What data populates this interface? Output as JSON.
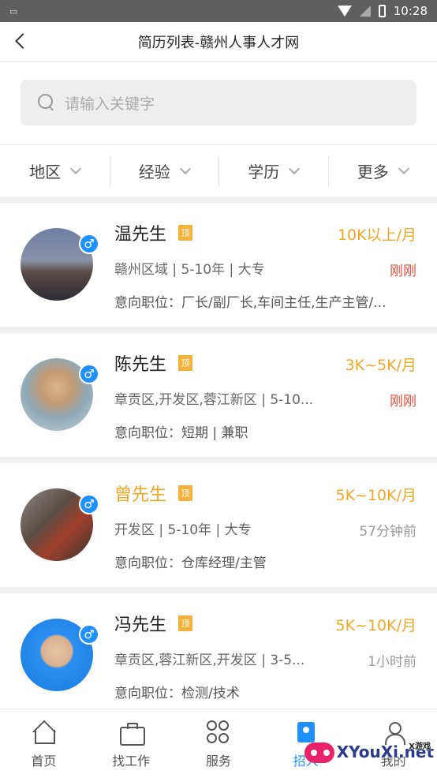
{
  "status_bar": {
    "left_icon": "notification-icon",
    "time": "10:28"
  },
  "header": {
    "title": "简历列表-赣州人事人才网"
  },
  "search": {
    "placeholder": "请输入关键字"
  },
  "filters": [
    {
      "label": "地区"
    },
    {
      "label": "经验"
    },
    {
      "label": "学历"
    },
    {
      "label": "更多"
    }
  ],
  "top_badge": "顶",
  "gender_symbol": "♂",
  "accent_color": "#f5a623",
  "link_blue": "#1e90ff",
  "resumes": [
    {
      "name": "温先生",
      "highlighted": false,
      "salary": "10K以上/月",
      "info": "赣州区域 | 5-10年 | 大专",
      "time": "刚刚",
      "time_new": true,
      "intent": "意向职位：厂长/副厂长,车间主任,生产主管/..."
    },
    {
      "name": "陈先生",
      "highlighted": false,
      "salary": "3K~5K/月",
      "info": "章贡区,开发区,蓉江新区 | 5-10...",
      "time": "刚刚",
      "time_new": true,
      "intent": "意向职位：短期 | 兼职"
    },
    {
      "name": "曾先生",
      "highlighted": true,
      "salary": "5K~10K/月",
      "info": "开发区 | 5-10年 | 大专",
      "time": "57分钟前",
      "time_new": false,
      "intent": "意向职位：仓库经理/主管"
    },
    {
      "name": "冯先生",
      "highlighted": false,
      "salary": "5K~10K/月",
      "info": "章贡区,蓉江新区,开发区 | 3-5...",
      "time": "1小时前",
      "time_new": false,
      "intent": "意向职位：检测/技术"
    }
  ],
  "tabs": [
    {
      "label": "首页",
      "icon": "home-icon"
    },
    {
      "label": "找工作",
      "icon": "briefcase-icon"
    },
    {
      "label": "服务",
      "icon": "services-icon"
    },
    {
      "label": "招人",
      "icon": "hire-icon",
      "active": true
    },
    {
      "label": "我的",
      "icon": "profile-icon"
    }
  ],
  "watermark": {
    "text": "XYouXi.net",
    "sub": "X游戏"
  }
}
